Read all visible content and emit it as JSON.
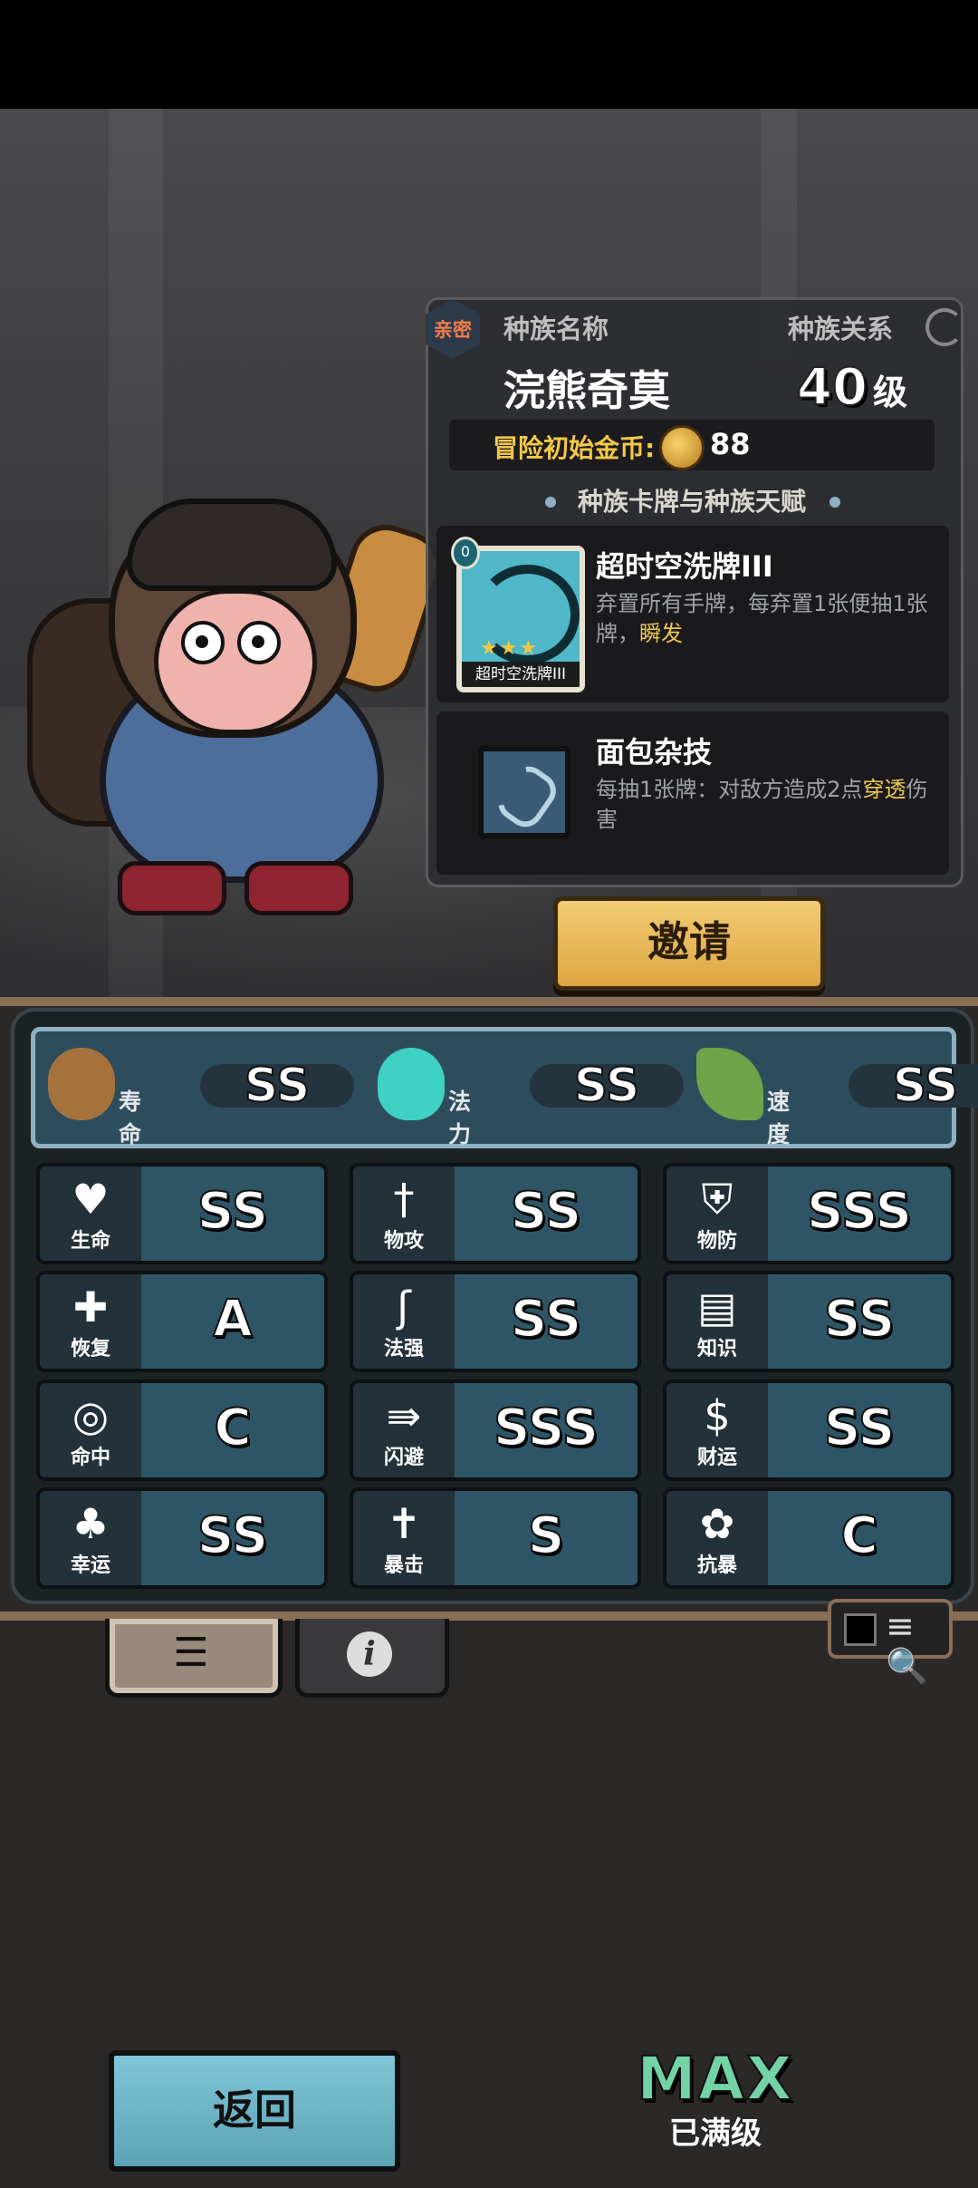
{
  "race": {
    "relation_badge": "亲密",
    "name_label": "种族名称",
    "relation_label": "种族关系",
    "name": "浣熊奇莫",
    "level": "40",
    "level_unit": "级",
    "start_gold_label": "冒险初始金币:",
    "start_gold": "88",
    "section_title": "种族卡牌与种族天赋"
  },
  "card": {
    "cost": "0",
    "image_caption": "超时空洗牌III",
    "stars": "★★★",
    "title": "超时空洗牌III",
    "desc_prefix": "弃置所有手牌，每弃置1张便抽1张牌，",
    "desc_highlight": "瞬发"
  },
  "talent": {
    "title": "面包杂技",
    "desc_prefix": "每抽1张牌：对敌方造成2点",
    "desc_highlight": "穿透",
    "desc_suffix": "伤害"
  },
  "invite_label": "邀请",
  "traits": [
    {
      "name": "寿命",
      "grade": "SS",
      "icon": "mushroom-head-icon"
    },
    {
      "name": "法力",
      "grade": "SS",
      "icon": "flame-icon"
    },
    {
      "name": "速度",
      "grade": "SS",
      "icon": "wing-icon"
    }
  ],
  "stats": [
    {
      "name": "生命",
      "grade": "SS",
      "icon": "heart-icon",
      "glyph": "♥"
    },
    {
      "name": "物攻",
      "grade": "SS",
      "icon": "sword-icon",
      "glyph": "†"
    },
    {
      "name": "物防",
      "grade": "SSS",
      "icon": "armor-icon",
      "glyph": "⛨"
    },
    {
      "name": "恢复",
      "grade": "A",
      "icon": "heart-plus-icon",
      "glyph": "✚"
    },
    {
      "name": "法强",
      "grade": "SS",
      "icon": "staff-icon",
      "glyph": "ʃ"
    },
    {
      "name": "知识",
      "grade": "SS",
      "icon": "book-icon",
      "glyph": "▤"
    },
    {
      "name": "命中",
      "grade": "C",
      "icon": "target-icon",
      "glyph": "◎"
    },
    {
      "name": "闪避",
      "grade": "SSS",
      "icon": "dash-arrow-icon",
      "glyph": "⇛"
    },
    {
      "name": "财运",
      "grade": "SS",
      "icon": "coin-icon",
      "glyph": "$"
    },
    {
      "name": "幸运",
      "grade": "SS",
      "icon": "clover-icon",
      "glyph": "♣"
    },
    {
      "name": "暴击",
      "grade": "S",
      "icon": "crit-sword-icon",
      "glyph": "✝"
    },
    {
      "name": "抗暴",
      "grade": "C",
      "icon": "shield-flower-icon",
      "glyph": "✿"
    }
  ],
  "tabs": {
    "list_glyph": "☰",
    "info_glyph": "i"
  },
  "filter_glyph": "≡🔍",
  "back_label": "返回",
  "max_label": "MAX",
  "max_sub": "已满级"
}
